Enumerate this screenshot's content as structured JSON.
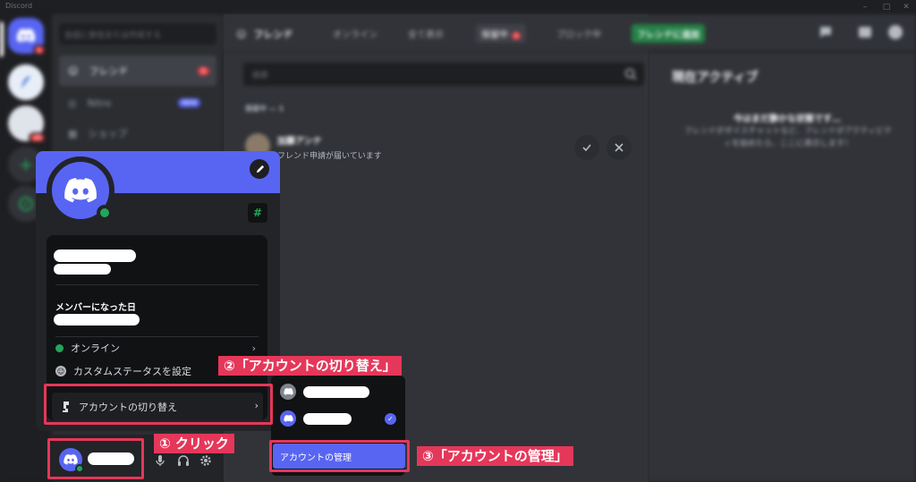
{
  "window": {
    "title": "Discord"
  },
  "server_rail": {
    "home_badge": "1",
    "server2_badge": "20"
  },
  "channels": {
    "search_placeholder": "会話に参加または作成する",
    "nav": [
      {
        "label": "フレンド",
        "badge": "1"
      },
      {
        "label": "Nitro",
        "badge": "NEW"
      },
      {
        "label": "ショップ"
      }
    ]
  },
  "topbar": {
    "title": "フレンド",
    "tabs": [
      {
        "label": "オンライン"
      },
      {
        "label": "全て表示"
      },
      {
        "label": "保留中",
        "badge": "1"
      },
      {
        "label": "ブロック中"
      },
      {
        "label": "フレンドに追加"
      }
    ]
  },
  "friends": {
    "search_placeholder": "検索",
    "section_label": "保留中 — 1",
    "request": {
      "name": "加藤アンナ",
      "subtitle": "フレンド申請が届いています"
    }
  },
  "activity": {
    "heading": "現在アクティブ",
    "title": "今はまだ静かな状態です…",
    "description": "フレンドがボイスチャットなど、フレンドがアクティビティを始めたら、ここに表示します！"
  },
  "profile_popout": {
    "member_since_label": "メンバーになった日",
    "status_label": "オンライン",
    "custom_status_label": "カスタムステータスを設定",
    "switch_account_label": "アカウントの切り替え",
    "nitro_glyph": "#"
  },
  "account_submenu": {
    "manage_label": "アカウントの管理"
  },
  "annotations": {
    "callout1": "① クリック",
    "callout2": "②「アカウントの切り替え」",
    "callout3": "③「アカウントの管理」"
  },
  "colors": {
    "blurple": "#5865f2",
    "online": "#23a55a",
    "danger": "#f23f43",
    "highlight": "#e5375a"
  }
}
